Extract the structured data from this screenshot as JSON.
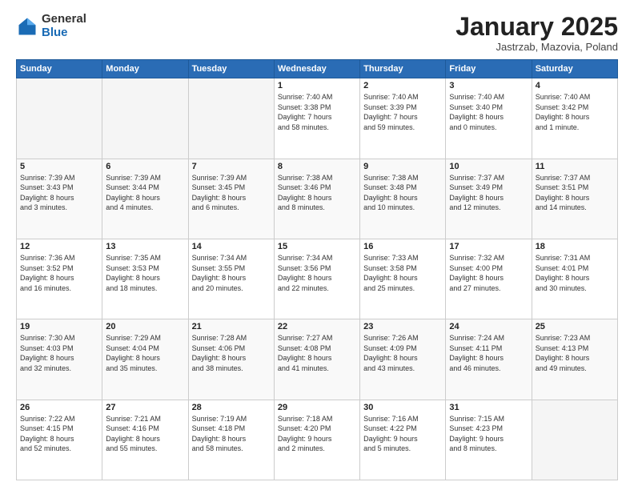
{
  "logo": {
    "general": "General",
    "blue": "Blue"
  },
  "header": {
    "month": "January 2025",
    "location": "Jastrzab, Mazovia, Poland"
  },
  "weekdays": [
    "Sunday",
    "Monday",
    "Tuesday",
    "Wednesday",
    "Thursday",
    "Friday",
    "Saturday"
  ],
  "weeks": [
    [
      {
        "day": "",
        "info": ""
      },
      {
        "day": "",
        "info": ""
      },
      {
        "day": "",
        "info": ""
      },
      {
        "day": "1",
        "info": "Sunrise: 7:40 AM\nSunset: 3:38 PM\nDaylight: 7 hours\nand 58 minutes."
      },
      {
        "day": "2",
        "info": "Sunrise: 7:40 AM\nSunset: 3:39 PM\nDaylight: 7 hours\nand 59 minutes."
      },
      {
        "day": "3",
        "info": "Sunrise: 7:40 AM\nSunset: 3:40 PM\nDaylight: 8 hours\nand 0 minutes."
      },
      {
        "day": "4",
        "info": "Sunrise: 7:40 AM\nSunset: 3:42 PM\nDaylight: 8 hours\nand 1 minute."
      }
    ],
    [
      {
        "day": "5",
        "info": "Sunrise: 7:39 AM\nSunset: 3:43 PM\nDaylight: 8 hours\nand 3 minutes."
      },
      {
        "day": "6",
        "info": "Sunrise: 7:39 AM\nSunset: 3:44 PM\nDaylight: 8 hours\nand 4 minutes."
      },
      {
        "day": "7",
        "info": "Sunrise: 7:39 AM\nSunset: 3:45 PM\nDaylight: 8 hours\nand 6 minutes."
      },
      {
        "day": "8",
        "info": "Sunrise: 7:38 AM\nSunset: 3:46 PM\nDaylight: 8 hours\nand 8 minutes."
      },
      {
        "day": "9",
        "info": "Sunrise: 7:38 AM\nSunset: 3:48 PM\nDaylight: 8 hours\nand 10 minutes."
      },
      {
        "day": "10",
        "info": "Sunrise: 7:37 AM\nSunset: 3:49 PM\nDaylight: 8 hours\nand 12 minutes."
      },
      {
        "day": "11",
        "info": "Sunrise: 7:37 AM\nSunset: 3:51 PM\nDaylight: 8 hours\nand 14 minutes."
      }
    ],
    [
      {
        "day": "12",
        "info": "Sunrise: 7:36 AM\nSunset: 3:52 PM\nDaylight: 8 hours\nand 16 minutes."
      },
      {
        "day": "13",
        "info": "Sunrise: 7:35 AM\nSunset: 3:53 PM\nDaylight: 8 hours\nand 18 minutes."
      },
      {
        "day": "14",
        "info": "Sunrise: 7:34 AM\nSunset: 3:55 PM\nDaylight: 8 hours\nand 20 minutes."
      },
      {
        "day": "15",
        "info": "Sunrise: 7:34 AM\nSunset: 3:56 PM\nDaylight: 8 hours\nand 22 minutes."
      },
      {
        "day": "16",
        "info": "Sunrise: 7:33 AM\nSunset: 3:58 PM\nDaylight: 8 hours\nand 25 minutes."
      },
      {
        "day": "17",
        "info": "Sunrise: 7:32 AM\nSunset: 4:00 PM\nDaylight: 8 hours\nand 27 minutes."
      },
      {
        "day": "18",
        "info": "Sunrise: 7:31 AM\nSunset: 4:01 PM\nDaylight: 8 hours\nand 30 minutes."
      }
    ],
    [
      {
        "day": "19",
        "info": "Sunrise: 7:30 AM\nSunset: 4:03 PM\nDaylight: 8 hours\nand 32 minutes."
      },
      {
        "day": "20",
        "info": "Sunrise: 7:29 AM\nSunset: 4:04 PM\nDaylight: 8 hours\nand 35 minutes."
      },
      {
        "day": "21",
        "info": "Sunrise: 7:28 AM\nSunset: 4:06 PM\nDaylight: 8 hours\nand 38 minutes."
      },
      {
        "day": "22",
        "info": "Sunrise: 7:27 AM\nSunset: 4:08 PM\nDaylight: 8 hours\nand 41 minutes."
      },
      {
        "day": "23",
        "info": "Sunrise: 7:26 AM\nSunset: 4:09 PM\nDaylight: 8 hours\nand 43 minutes."
      },
      {
        "day": "24",
        "info": "Sunrise: 7:24 AM\nSunset: 4:11 PM\nDaylight: 8 hours\nand 46 minutes."
      },
      {
        "day": "25",
        "info": "Sunrise: 7:23 AM\nSunset: 4:13 PM\nDaylight: 8 hours\nand 49 minutes."
      }
    ],
    [
      {
        "day": "26",
        "info": "Sunrise: 7:22 AM\nSunset: 4:15 PM\nDaylight: 8 hours\nand 52 minutes."
      },
      {
        "day": "27",
        "info": "Sunrise: 7:21 AM\nSunset: 4:16 PM\nDaylight: 8 hours\nand 55 minutes."
      },
      {
        "day": "28",
        "info": "Sunrise: 7:19 AM\nSunset: 4:18 PM\nDaylight: 8 hours\nand 58 minutes."
      },
      {
        "day": "29",
        "info": "Sunrise: 7:18 AM\nSunset: 4:20 PM\nDaylight: 9 hours\nand 2 minutes."
      },
      {
        "day": "30",
        "info": "Sunrise: 7:16 AM\nSunset: 4:22 PM\nDaylight: 9 hours\nand 5 minutes."
      },
      {
        "day": "31",
        "info": "Sunrise: 7:15 AM\nSunset: 4:23 PM\nDaylight: 9 hours\nand 8 minutes."
      },
      {
        "day": "",
        "info": ""
      }
    ]
  ]
}
